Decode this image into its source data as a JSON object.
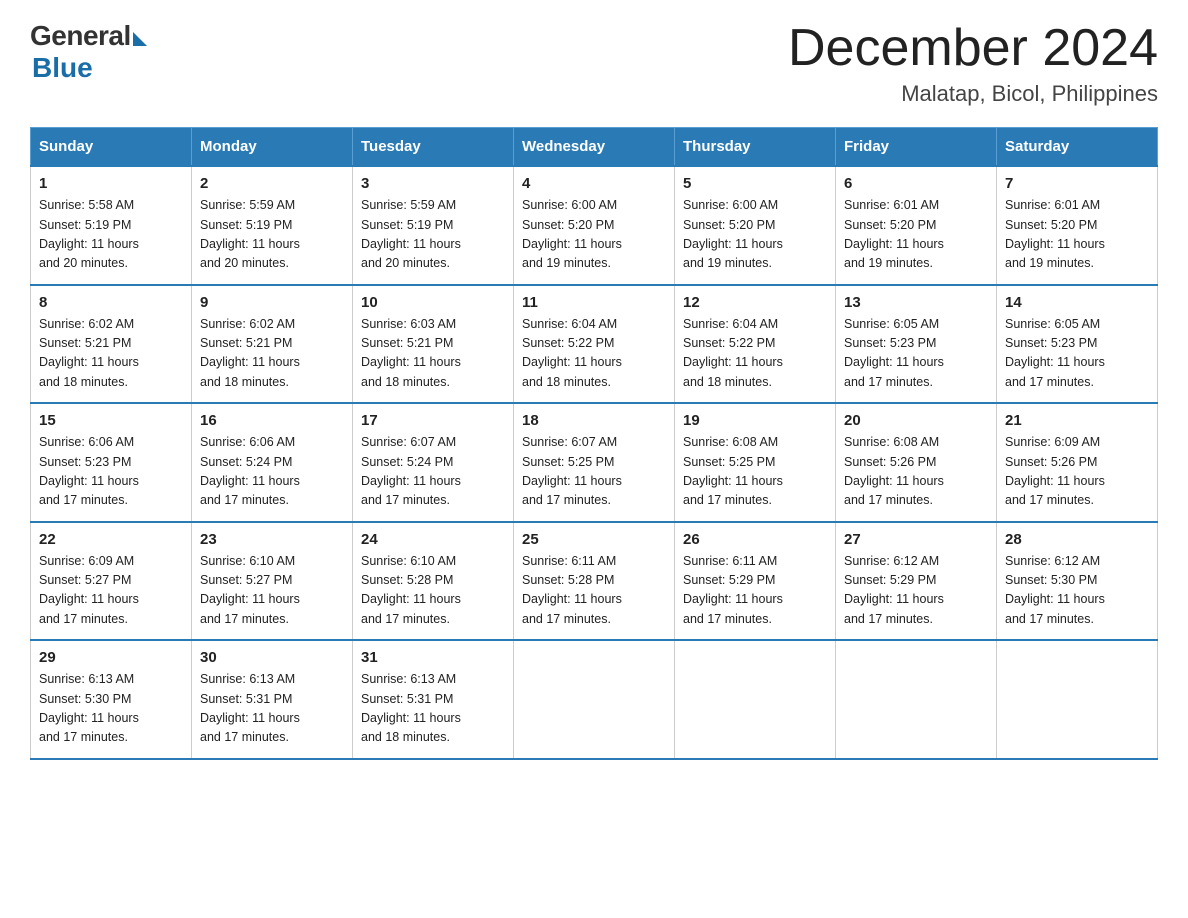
{
  "logo": {
    "general": "General",
    "blue": "Blue"
  },
  "title": "December 2024",
  "subtitle": "Malatap, Bicol, Philippines",
  "days_header": [
    "Sunday",
    "Monday",
    "Tuesday",
    "Wednesday",
    "Thursday",
    "Friday",
    "Saturday"
  ],
  "weeks": [
    [
      {
        "num": "1",
        "info": "Sunrise: 5:58 AM\nSunset: 5:19 PM\nDaylight: 11 hours\nand 20 minutes."
      },
      {
        "num": "2",
        "info": "Sunrise: 5:59 AM\nSunset: 5:19 PM\nDaylight: 11 hours\nand 20 minutes."
      },
      {
        "num": "3",
        "info": "Sunrise: 5:59 AM\nSunset: 5:19 PM\nDaylight: 11 hours\nand 20 minutes."
      },
      {
        "num": "4",
        "info": "Sunrise: 6:00 AM\nSunset: 5:20 PM\nDaylight: 11 hours\nand 19 minutes."
      },
      {
        "num": "5",
        "info": "Sunrise: 6:00 AM\nSunset: 5:20 PM\nDaylight: 11 hours\nand 19 minutes."
      },
      {
        "num": "6",
        "info": "Sunrise: 6:01 AM\nSunset: 5:20 PM\nDaylight: 11 hours\nand 19 minutes."
      },
      {
        "num": "7",
        "info": "Sunrise: 6:01 AM\nSunset: 5:20 PM\nDaylight: 11 hours\nand 19 minutes."
      }
    ],
    [
      {
        "num": "8",
        "info": "Sunrise: 6:02 AM\nSunset: 5:21 PM\nDaylight: 11 hours\nand 18 minutes."
      },
      {
        "num": "9",
        "info": "Sunrise: 6:02 AM\nSunset: 5:21 PM\nDaylight: 11 hours\nand 18 minutes."
      },
      {
        "num": "10",
        "info": "Sunrise: 6:03 AM\nSunset: 5:21 PM\nDaylight: 11 hours\nand 18 minutes."
      },
      {
        "num": "11",
        "info": "Sunrise: 6:04 AM\nSunset: 5:22 PM\nDaylight: 11 hours\nand 18 minutes."
      },
      {
        "num": "12",
        "info": "Sunrise: 6:04 AM\nSunset: 5:22 PM\nDaylight: 11 hours\nand 18 minutes."
      },
      {
        "num": "13",
        "info": "Sunrise: 6:05 AM\nSunset: 5:23 PM\nDaylight: 11 hours\nand 17 minutes."
      },
      {
        "num": "14",
        "info": "Sunrise: 6:05 AM\nSunset: 5:23 PM\nDaylight: 11 hours\nand 17 minutes."
      }
    ],
    [
      {
        "num": "15",
        "info": "Sunrise: 6:06 AM\nSunset: 5:23 PM\nDaylight: 11 hours\nand 17 minutes."
      },
      {
        "num": "16",
        "info": "Sunrise: 6:06 AM\nSunset: 5:24 PM\nDaylight: 11 hours\nand 17 minutes."
      },
      {
        "num": "17",
        "info": "Sunrise: 6:07 AM\nSunset: 5:24 PM\nDaylight: 11 hours\nand 17 minutes."
      },
      {
        "num": "18",
        "info": "Sunrise: 6:07 AM\nSunset: 5:25 PM\nDaylight: 11 hours\nand 17 minutes."
      },
      {
        "num": "19",
        "info": "Sunrise: 6:08 AM\nSunset: 5:25 PM\nDaylight: 11 hours\nand 17 minutes."
      },
      {
        "num": "20",
        "info": "Sunrise: 6:08 AM\nSunset: 5:26 PM\nDaylight: 11 hours\nand 17 minutes."
      },
      {
        "num": "21",
        "info": "Sunrise: 6:09 AM\nSunset: 5:26 PM\nDaylight: 11 hours\nand 17 minutes."
      }
    ],
    [
      {
        "num": "22",
        "info": "Sunrise: 6:09 AM\nSunset: 5:27 PM\nDaylight: 11 hours\nand 17 minutes."
      },
      {
        "num": "23",
        "info": "Sunrise: 6:10 AM\nSunset: 5:27 PM\nDaylight: 11 hours\nand 17 minutes."
      },
      {
        "num": "24",
        "info": "Sunrise: 6:10 AM\nSunset: 5:28 PM\nDaylight: 11 hours\nand 17 minutes."
      },
      {
        "num": "25",
        "info": "Sunrise: 6:11 AM\nSunset: 5:28 PM\nDaylight: 11 hours\nand 17 minutes."
      },
      {
        "num": "26",
        "info": "Sunrise: 6:11 AM\nSunset: 5:29 PM\nDaylight: 11 hours\nand 17 minutes."
      },
      {
        "num": "27",
        "info": "Sunrise: 6:12 AM\nSunset: 5:29 PM\nDaylight: 11 hours\nand 17 minutes."
      },
      {
        "num": "28",
        "info": "Sunrise: 6:12 AM\nSunset: 5:30 PM\nDaylight: 11 hours\nand 17 minutes."
      }
    ],
    [
      {
        "num": "29",
        "info": "Sunrise: 6:13 AM\nSunset: 5:30 PM\nDaylight: 11 hours\nand 17 minutes."
      },
      {
        "num": "30",
        "info": "Sunrise: 6:13 AM\nSunset: 5:31 PM\nDaylight: 11 hours\nand 17 minutes."
      },
      {
        "num": "31",
        "info": "Sunrise: 6:13 AM\nSunset: 5:31 PM\nDaylight: 11 hours\nand 18 minutes."
      },
      null,
      null,
      null,
      null
    ]
  ]
}
